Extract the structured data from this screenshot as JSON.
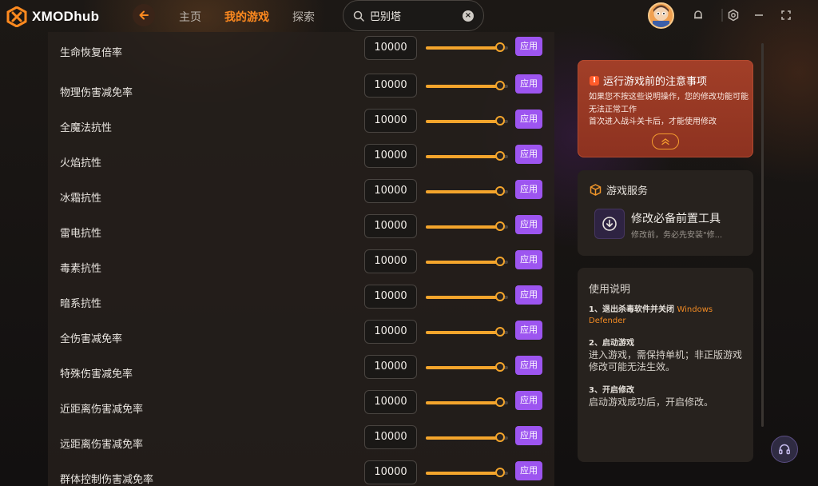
{
  "app": {
    "name": "XMODhub"
  },
  "nav": {
    "home": "主页",
    "my_games": "我的游戏",
    "explore": "探索"
  },
  "search": {
    "value": "巴别塔"
  },
  "accent_color": "#ff8a1f",
  "apply_color": "#9d55f0",
  "settings": [
    {
      "label": "生命恢复倍率",
      "value": "10000",
      "level": 0.9,
      "apply": "应用"
    },
    {
      "label": "物理伤害减免率",
      "value": "10000",
      "level": 0.9,
      "apply": "应用"
    },
    {
      "label": "全魔法抗性",
      "value": "10000",
      "level": 0.9,
      "apply": "应用"
    },
    {
      "label": "火焰抗性",
      "value": "10000",
      "level": 0.9,
      "apply": "应用"
    },
    {
      "label": "冰霜抗性",
      "value": "10000",
      "level": 0.9,
      "apply": "应用"
    },
    {
      "label": "雷电抗性",
      "value": "10000",
      "level": 0.9,
      "apply": "应用"
    },
    {
      "label": "毒素抗性",
      "value": "10000",
      "level": 0.9,
      "apply": "应用"
    },
    {
      "label": "暗系抗性",
      "value": "10000",
      "level": 0.9,
      "apply": "应用"
    },
    {
      "label": "全伤害减免率",
      "value": "10000",
      "level": 0.9,
      "apply": "应用"
    },
    {
      "label": "特殊伤害减免率",
      "value": "10000",
      "level": 0.9,
      "apply": "应用"
    },
    {
      "label": "近距离伤害减免率",
      "value": "10000",
      "level": 0.9,
      "apply": "应用"
    },
    {
      "label": "远距离伤害减免率",
      "value": "10000",
      "level": 0.9,
      "apply": "应用"
    },
    {
      "label": "群体控制伤害减免率",
      "value": "10000",
      "level": 0.9,
      "apply": "应用"
    }
  ],
  "notice": {
    "title": "运行游戏前的注意事项",
    "line1": "如果您不按这些说明操作，您的修改功能可能无法正常工作",
    "line2": "首次进入战斗关卡后，才能使用修改"
  },
  "service": {
    "title": "游戏服务",
    "tool_name": "修改必备前置工具",
    "tool_desc": "修改前，务必先安装\"修..."
  },
  "guide": {
    "title": "使用说明",
    "step1_title": "1、退出杀毒软件并关闭",
    "step1_highlight": "Windows Defender",
    "step2_title": "2、启动游戏",
    "step2_desc": "进入游戏，需保持单机；非正版游戏修改可能无法生效。",
    "step3_title": "3、开启修改",
    "step3_desc": "启动游戏成功后，开启修改。"
  }
}
